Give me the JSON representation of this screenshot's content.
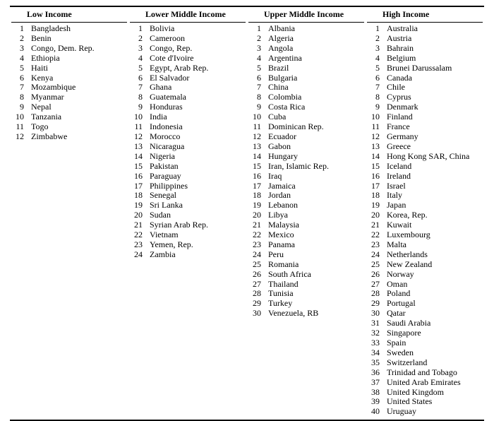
{
  "columns": [
    {
      "header": "Low Income",
      "items": [
        "Bangladesh",
        "Benin",
        "Congo, Dem. Rep.",
        "Ethiopia",
        "Haiti",
        "Kenya",
        "Mozambique",
        "Myanmar",
        "Nepal",
        "Tanzania",
        "Togo",
        "Zimbabwe"
      ]
    },
    {
      "header": "Lower Middle Income",
      "items": [
        "Bolivia",
        "Cameroon",
        "Congo, Rep.",
        "Cote d'Ivoire",
        "Egypt, Arab Rep.",
        "El Salvador",
        "Ghana",
        "Guatemala",
        "Honduras",
        "India",
        "Indonesia",
        "Morocco",
        "Nicaragua",
        "Nigeria",
        "Pakistan",
        "Paraguay",
        "Philippines",
        "Senegal",
        "Sri Lanka",
        "Sudan",
        "Syrian Arab Rep.",
        "Vietnam",
        "Yemen, Rep.",
        "Zambia"
      ]
    },
    {
      "header": "Upper Middle Income",
      "items": [
        "Albania",
        "Algeria",
        "Angola",
        "Argentina",
        "Brazil",
        "Bulgaria",
        "China",
        "Colombia",
        "Costa Rica",
        "Cuba",
        "Dominican Rep.",
        "Ecuador",
        "Gabon",
        "Hungary",
        "Iran, Islamic Rep.",
        "Iraq",
        "Jamaica",
        "Jordan",
        "Lebanon",
        "Libya",
        "Malaysia",
        "Mexico",
        "Panama",
        "Peru",
        "Romania",
        "South Africa",
        "Thailand",
        "Tunisia",
        "Turkey",
        "Venezuela, RB"
      ]
    },
    {
      "header": "High Income",
      "items": [
        "Australia",
        "Austria",
        "Bahrain",
        "Belgium",
        "Brunei Darussalam",
        "Canada",
        "Chile",
        "Cyprus",
        "Denmark",
        "Finland",
        "France",
        "Germany",
        "Greece",
        "Hong Kong SAR, China",
        "Iceland",
        "Ireland",
        "Israel",
        "Italy",
        "Japan",
        "Korea, Rep.",
        "Kuwait",
        "Luxembourg",
        "Malta",
        "Netherlands",
        "New Zealand",
        "Norway",
        "Oman",
        "Poland",
        "Portugal",
        "Qatar",
        "Saudi Arabia",
        "Singapore",
        "Spain",
        "Sweden",
        "Switzerland",
        "Trinidad and Tobago",
        "United Arab Emirates",
        "United Kingdom",
        "United States",
        "Uruguay"
      ]
    }
  ]
}
